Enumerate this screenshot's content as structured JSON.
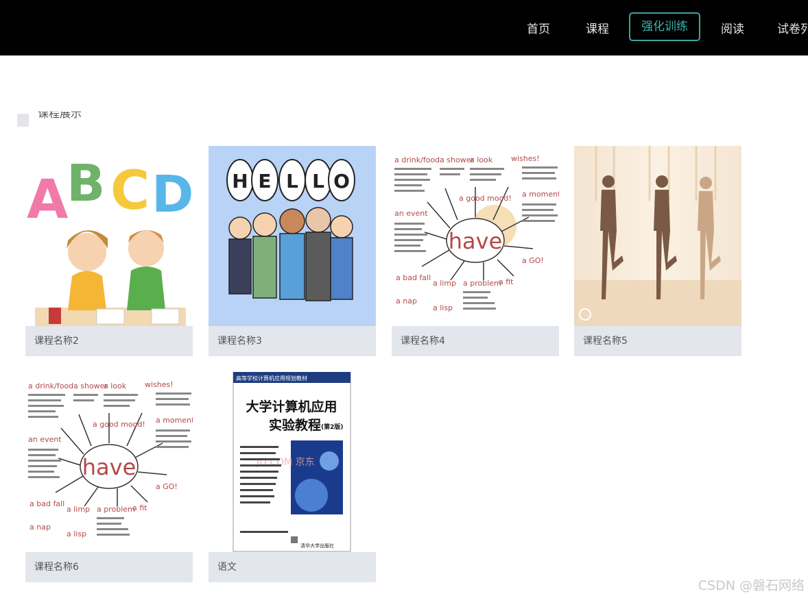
{
  "nav": {
    "items": [
      {
        "label": "首页"
      },
      {
        "label": "课程"
      },
      {
        "label": "强化训练"
      },
      {
        "label": "阅读"
      },
      {
        "label": "试卷列"
      }
    ],
    "active_index": 2
  },
  "section": {
    "title": "课程展示"
  },
  "courses": [
    {
      "name": "课程名称2",
      "image": "abcd-kids-icon"
    },
    {
      "name": "课程名称3",
      "image": "hello-people-icon"
    },
    {
      "name": "课程名称4",
      "image": "have-mindmap-icon"
    },
    {
      "name": "课程名称5",
      "image": "yoga-icon"
    },
    {
      "name": "课程名称6",
      "image": "have-mindmap-icon"
    },
    {
      "name": "语文",
      "image": "book-cover-icon"
    }
  ],
  "mindmap": {
    "center": "have",
    "topics": [
      "a drink/food",
      "a shower",
      "a look",
      "wishes!",
      "a moment",
      "a GO!",
      "a fit",
      "a problem",
      "a limp",
      "a lisp",
      "a nap",
      "a bad fall",
      "an event",
      "a good mood!"
    ]
  },
  "book": {
    "header": "高等学校计算机应用规划教材",
    "title_line1": "大学计算机应用",
    "title_line2": "实验教程",
    "edition": "(第2版)",
    "publisher": "清华大学出版社",
    "overlay": "JD.COM 京东"
  },
  "hello_letters": [
    "H",
    "E",
    "L",
    "L",
    "O"
  ],
  "abcd_letters": [
    "A",
    "B",
    "C",
    "D"
  ],
  "watermark": "CSDN @磐石网络",
  "colors": {
    "accent": "#3aa6a0",
    "topbar": "#000000",
    "caption_bg": "#e3e6ec"
  }
}
